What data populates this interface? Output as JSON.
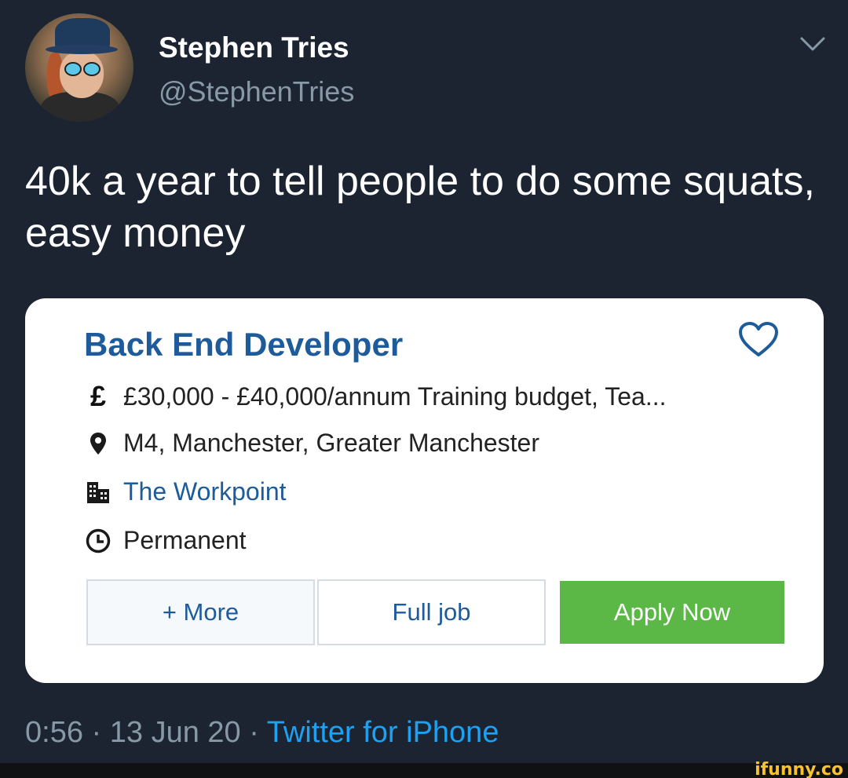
{
  "author": {
    "name": "Stephen Tries",
    "handle": "@StephenTries"
  },
  "tweet": {
    "text": "40k a year to tell people to do some squats, easy money"
  },
  "card": {
    "title": "Back End Developer",
    "salary": "£30,000 - £40,000/annum Training budget, Tea...",
    "location": "M4, Manchester, Greater Manchester",
    "company": "The Workpoint",
    "job_type": "Permanent",
    "buttons": {
      "more": "+ More",
      "full_job": "Full job",
      "apply": "Apply Now"
    },
    "icons": [
      "pound-icon",
      "location-pin-icon",
      "building-icon",
      "clock-icon",
      "heart-icon"
    ]
  },
  "meta": {
    "time": "0:56",
    "date": "13 Jun 20",
    "separator": "·",
    "source": "Twitter for iPhone"
  },
  "watermark": "ifunny.co",
  "colors": {
    "background": "#1b2430",
    "link_blue": "#1e5b9a",
    "twitter_blue": "#1da1f2",
    "apply_green": "#5bb846",
    "muted": "#8899a6"
  }
}
